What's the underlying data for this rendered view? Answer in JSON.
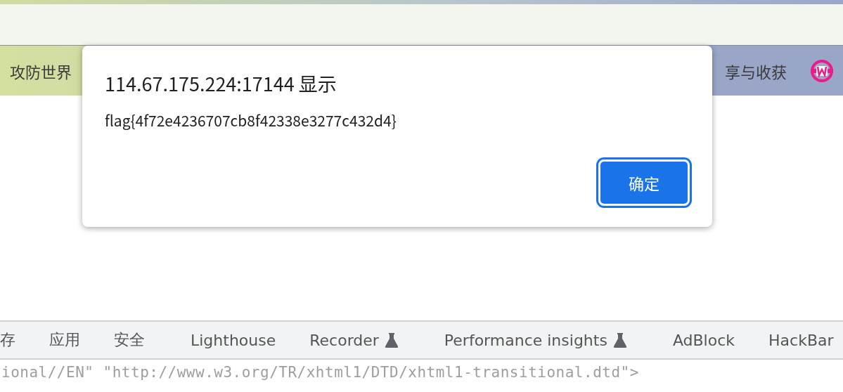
{
  "site_nav": {
    "brand": "攻防世界",
    "right_link": "享与收获"
  },
  "alert_dialog": {
    "title": "114.67.175.224:17144 显示",
    "message": "flag{4f72e4236707cb8f42338e3277c432d4}",
    "button": "确定"
  },
  "devtools": {
    "tabs": [
      {
        "label": "存",
        "experimental": false
      },
      {
        "label": "应用",
        "experimental": false
      },
      {
        "label": "安全",
        "experimental": false
      },
      {
        "label": "Lighthouse",
        "experimental": false
      },
      {
        "label": "Recorder",
        "experimental": true
      },
      {
        "label": "Performance insights",
        "experimental": true
      },
      {
        "label": "AdBlock",
        "experimental": false
      },
      {
        "label": "HackBar",
        "experimental": false
      }
    ],
    "source_line": "ional//EN\" \"http://www.w3.org/TR/xhtml1/DTD/xhtml1-transitional.dtd\">"
  }
}
